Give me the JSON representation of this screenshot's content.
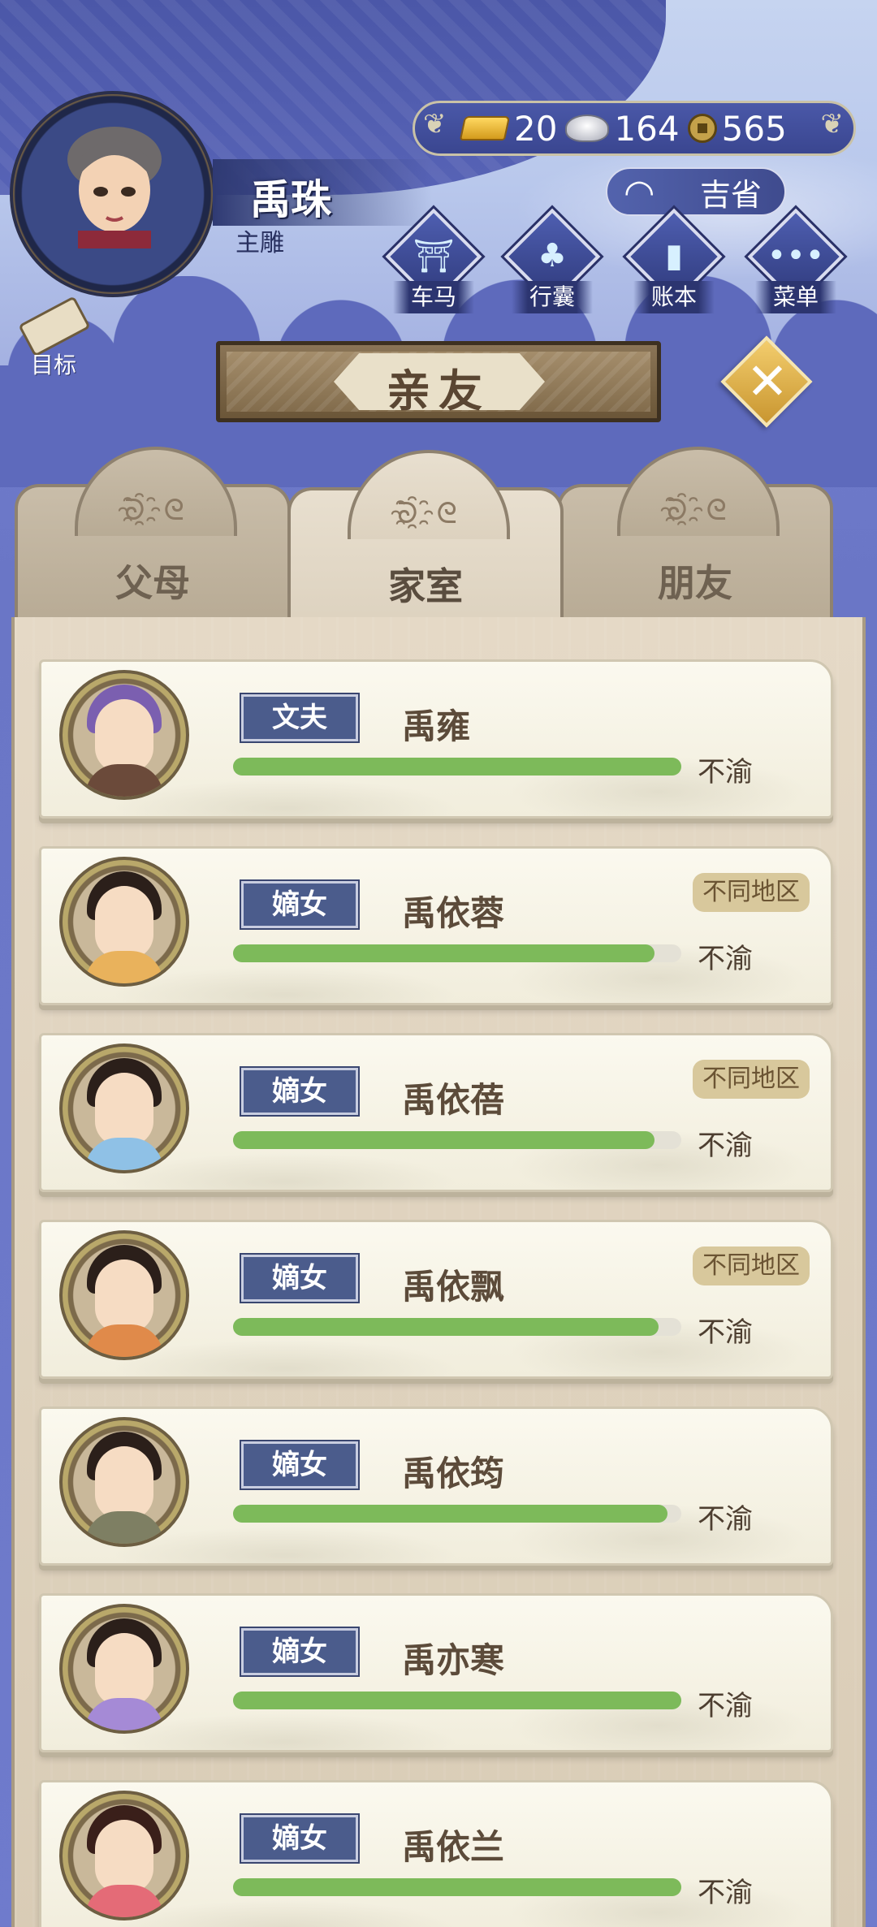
{
  "player": {
    "name": "禹珠",
    "title": "主雕"
  },
  "currency": {
    "gold": "20",
    "silver": "164",
    "coins": "565"
  },
  "weather": {
    "label": "吉省"
  },
  "menu": [
    {
      "label": "车马",
      "icon": "carriage-icon"
    },
    {
      "label": "行囊",
      "icon": "bag-icon"
    },
    {
      "label": "账本",
      "icon": "ledger-icon"
    },
    {
      "label": "菜单",
      "icon": "more-icon"
    }
  ],
  "goal": {
    "label": "目标"
  },
  "banner": {
    "title": "亲友"
  },
  "tabs": [
    {
      "label": "父母",
      "active": false
    },
    {
      "label": "家室",
      "active": true
    },
    {
      "label": "朋友",
      "active": false
    }
  ],
  "relations": [
    {
      "tag": "文夫",
      "name": "禹雍",
      "region": "",
      "status": "不渝",
      "affinity": 1.0,
      "body_color": "#6b4a3a",
      "hair_color": "#7b5fb0"
    },
    {
      "tag": "嫡女",
      "name": "禹依蓉",
      "region": "不同地区",
      "status": "不渝",
      "affinity": 0.94,
      "body_color": "#e9b25c",
      "hair_color": "#2b1f1a"
    },
    {
      "tag": "嫡女",
      "name": "禹依蓓",
      "region": "不同地区",
      "status": "不渝",
      "affinity": 0.94,
      "body_color": "#8fc1e6",
      "hair_color": "#2b1f1a"
    },
    {
      "tag": "嫡女",
      "name": "禹依飘",
      "region": "不同地区",
      "status": "不渝",
      "affinity": 0.95,
      "body_color": "#e08a4a",
      "hair_color": "#2b1f1a"
    },
    {
      "tag": "嫡女",
      "name": "禹依筠",
      "region": "",
      "status": "不渝",
      "affinity": 0.97,
      "body_color": "#7e7f63",
      "hair_color": "#2b1f1a"
    },
    {
      "tag": "嫡女",
      "name": "禹亦寒",
      "region": "",
      "status": "不渝",
      "affinity": 1.0,
      "body_color": "#a58ad6",
      "hair_color": "#2b1f1a"
    },
    {
      "tag": "嫡女",
      "name": "禹依兰",
      "region": "",
      "status": "不渝",
      "affinity": 1.0,
      "body_color": "#e46b77",
      "hair_color": "#3a1f1a"
    }
  ]
}
